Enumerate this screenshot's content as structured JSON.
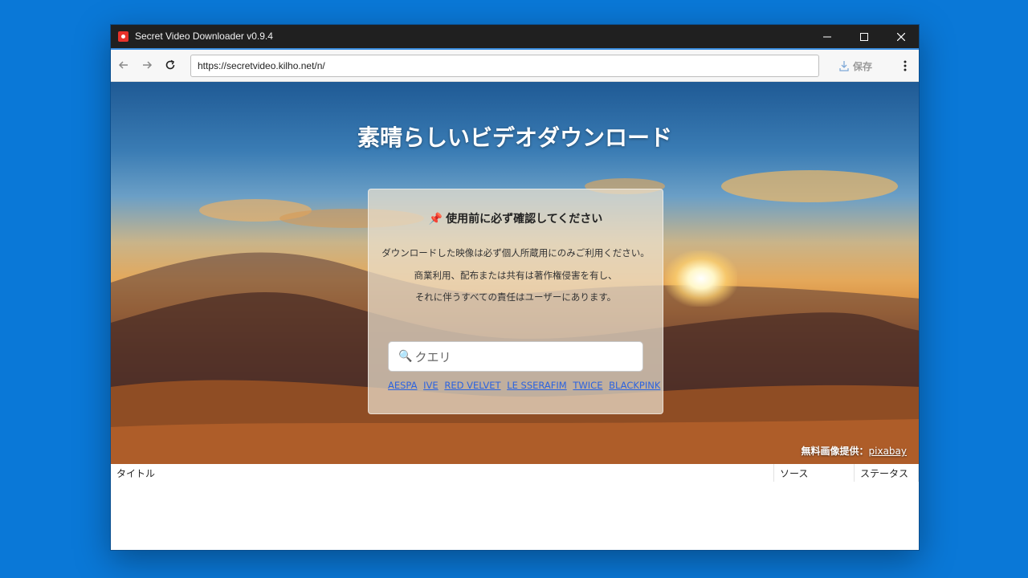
{
  "window": {
    "title": "Secret Video Downloader v0.9.4"
  },
  "toolbar": {
    "url": "https://secretvideo.kilho.net/n/",
    "save_label": "保存"
  },
  "hero": {
    "title": "素晴らしいビデオダウンロード",
    "panel": {
      "heading": "使用前に必ず確認してください",
      "pin_icon": "📌",
      "notice_lines": [
        "ダウンロードした映像は必ず個人所蔵用にのみご利用ください。",
        "商業利用、配布または共有は著作権侵害を有し、",
        "それに伴うすべての責任はユーザーにあります。"
      ],
      "search_placeholder": "クエリ",
      "tags": [
        "AESPA",
        "IVE",
        "RED VELVET",
        "LE SSERAFIM",
        "TWICE",
        "BLACKPINK"
      ]
    },
    "credit_label": "無料画像提供：",
    "credit_link": "pixabay"
  },
  "table": {
    "columns": [
      "タイトル",
      "ソース",
      "ステータス"
    ]
  },
  "colors": {
    "desktop": "#0a78d7",
    "titlebar": "#202020",
    "accent": "#3a8ee0",
    "link": "#2b63e0"
  }
}
